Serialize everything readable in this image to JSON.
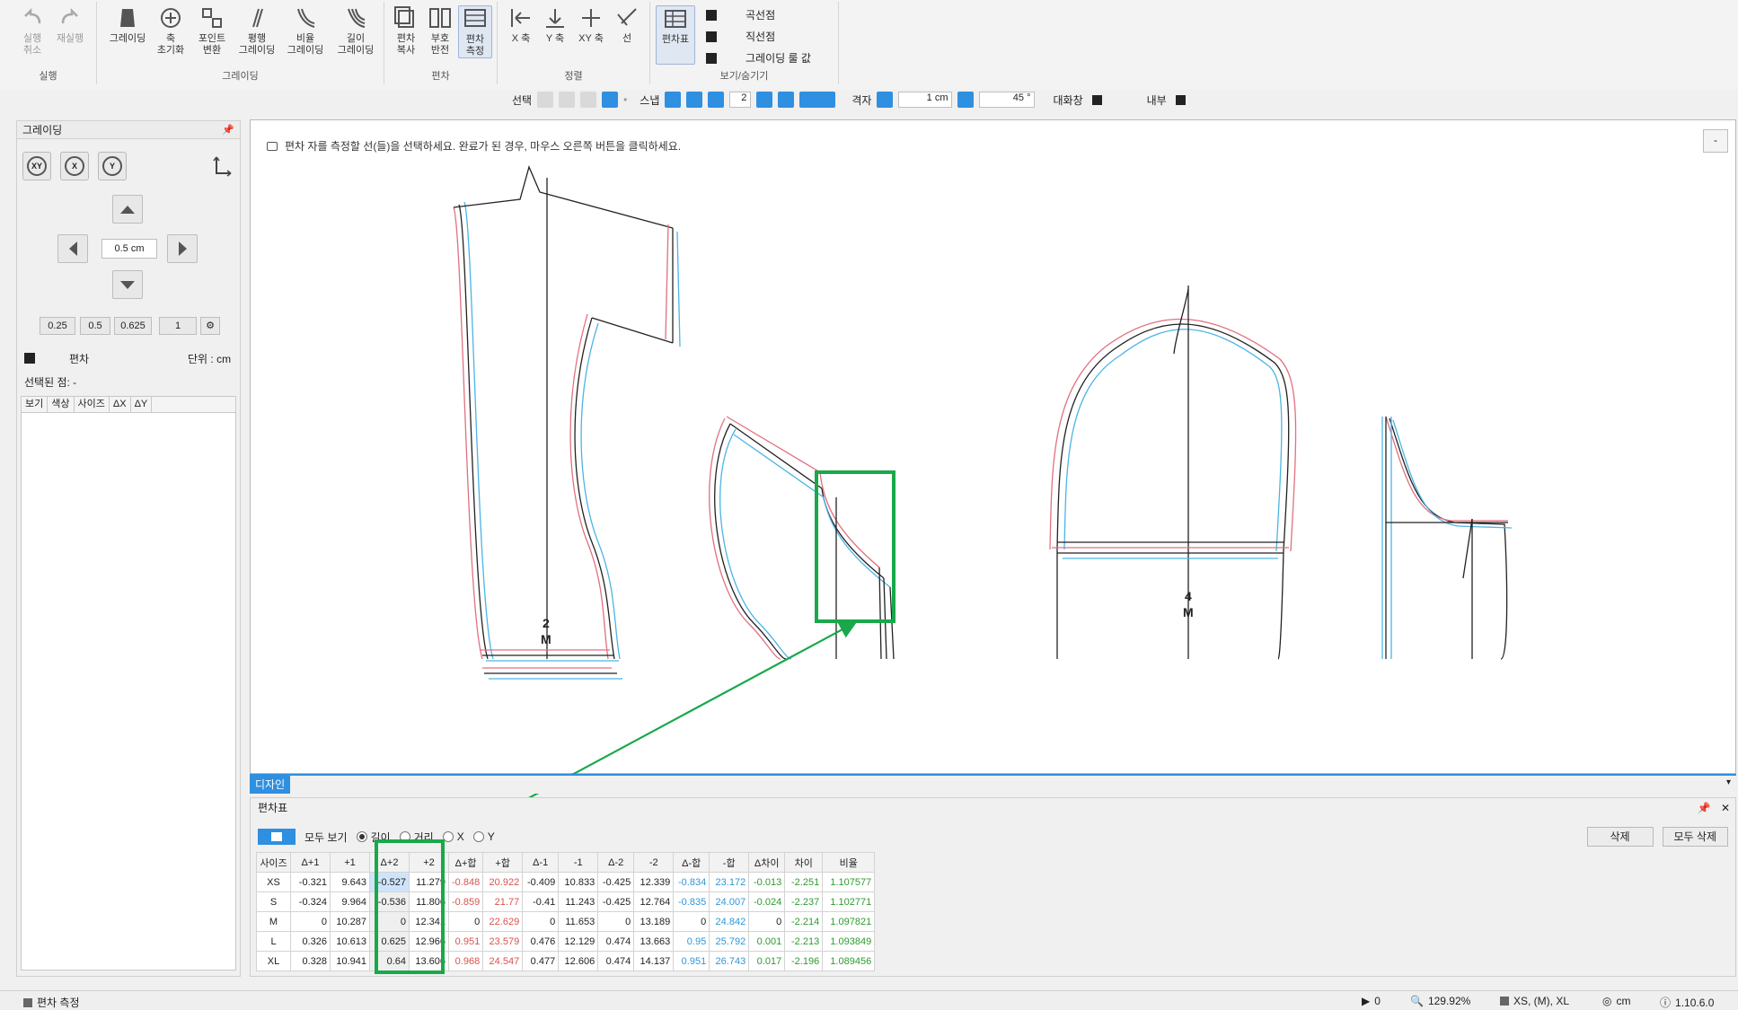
{
  "ribbon": {
    "groups": {
      "run": "실행",
      "grading": "그레이딩",
      "deviation": "편차",
      "align": "정렬",
      "view": "보기/숨기기"
    },
    "buttons": {
      "undo": "실행\n취소",
      "redo": "재실행",
      "grading": "그레이딩",
      "axis_reset": "축\n초기화",
      "point_convert": "포인트\n변환",
      "parallel_grading": "평행\n그레이딩",
      "ratio_grading": "비율\n그레이딩",
      "length_grading": "길이\n그레이딩",
      "dev_copy": "편차\n복사",
      "sign_flip": "부호\n반전",
      "dev_measure": "편차\n측정",
      "x_axis": "X 축",
      "y_axis": "Y 축",
      "xy_axis": "XY 축",
      "line": "선",
      "dev_table": "편차표"
    },
    "view_checks": [
      "곡선점",
      "직선점",
      "그레이딩 룰 값"
    ]
  },
  "optbar": {
    "select_label": "선택",
    "snap_label": "스냅",
    "snap_value": "2",
    "grid_label": "격자",
    "grid_value": "1 cm",
    "angle_value": "45 °",
    "dialog_label": "대화창",
    "inside_label": "내부"
  },
  "left_panel": {
    "title": "그레이딩",
    "axis_buttons": [
      "XY",
      "X",
      "Y"
    ],
    "step_value": "0.5 cm",
    "presets": [
      "0.25",
      "0.5",
      "0.625",
      "1"
    ],
    "deviation_label": "편차",
    "unit_label": "단위 : cm",
    "selected_point": "선택된 점: -",
    "table_headers": [
      "보기",
      "색상",
      "사이즈",
      "ΔX",
      "ΔY"
    ]
  },
  "canvas": {
    "hint": "편차 자를 측정할 선(들)을 선택하세요. 완료가 된 경우, 마우스 오른쪽 버튼을 클릭하세요.",
    "minimize": "-",
    "piece_labels": [
      {
        "num": "2",
        "size": "M"
      },
      {
        "num": "4",
        "size": "M"
      }
    ]
  },
  "design_tab": "디자인",
  "dev_panel": {
    "title": "편차표",
    "show_all": "모두 보기",
    "modes": [
      "길이",
      "거리",
      "X",
      "Y"
    ],
    "selected_mode": "길이",
    "delete": "삭제",
    "delete_all": "모두 삭제",
    "headers": [
      "사이즈",
      "Δ+1",
      "+1",
      "Δ+2",
      "+2",
      "Δ+합",
      "+합",
      "Δ-1",
      "-1",
      "Δ-2",
      "-2",
      "Δ-합",
      "-합",
      "Δ차이",
      "차이",
      "비율"
    ],
    "rows": [
      {
        "size": "XS",
        "cells": [
          "-0.321",
          "9.643",
          "-0.527",
          "11.279",
          "-0.848",
          "20.922",
          "-0.409",
          "10.833",
          "-0.425",
          "12.339",
          "-0.834",
          "23.172",
          "-0.013",
          "-2.251",
          "1.107577"
        ]
      },
      {
        "size": "S",
        "cells": [
          "-0.324",
          "9.964",
          "-0.536",
          "11.806",
          "-0.859",
          "21.77",
          "-0.41",
          "11.243",
          "-0.425",
          "12.764",
          "-0.835",
          "24.007",
          "-0.024",
          "-2.237",
          "1.102771"
        ]
      },
      {
        "size": "M",
        "cells": [
          "0",
          "10.287",
          "0",
          "12.341",
          "0",
          "22.629",
          "0",
          "11.653",
          "0",
          "13.189",
          "0",
          "24.842",
          "0",
          "-2.214",
          "1.097821"
        ]
      },
      {
        "size": "L",
        "cells": [
          "0.326",
          "10.613",
          "0.625",
          "12.966",
          "0.951",
          "23.579",
          "0.476",
          "12.129",
          "0.474",
          "13.663",
          "0.95",
          "25.792",
          "0.001",
          "-2.213",
          "1.093849"
        ]
      },
      {
        "size": "XL",
        "cells": [
          "0.328",
          "10.941",
          "0.64",
          "13.606",
          "0.968",
          "24.547",
          "0.477",
          "12.606",
          "0.474",
          "14.137",
          "0.951",
          "26.743",
          "0.017",
          "-2.196",
          "1.089456"
        ]
      }
    ]
  },
  "statusbar": {
    "mode": "편차 측정",
    "count": "0",
    "zoom": "129.92%",
    "sizes": "XS, (M), XL",
    "unit": "cm",
    "version": "1.10.6.0"
  },
  "colors": {
    "accent": "#2f8fe0",
    "highlight_box": "#19a84a",
    "pattern_red": "#e0707f",
    "pattern_blue": "#4bb4e6",
    "pattern_black": "#222222"
  }
}
